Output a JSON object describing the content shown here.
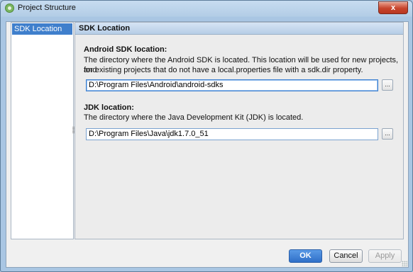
{
  "window": {
    "title": "Project Structure",
    "close_label": "x"
  },
  "sidebar": {
    "items": [
      {
        "label": "SDK Location",
        "selected": true
      }
    ]
  },
  "panel": {
    "header": "SDK Location",
    "android_sdk": {
      "heading": "Android SDK location:",
      "description_line1": "The directory where the Android SDK is located. This location will be used for new projects, and",
      "description_line2": "for existing projects that do not have a local.properties file with a sdk.dir property.",
      "path": "D:\\Program Files\\Android\\android-sdks",
      "browse_label": "..."
    },
    "jdk": {
      "heading": "JDK location:",
      "description": "The directory where the Java Development Kit (JDK) is located.",
      "path": "D:\\Program Files\\Java\\jdk1.7.0_51",
      "browse_label": "..."
    }
  },
  "buttons": {
    "ok": "OK",
    "cancel": "Cancel",
    "apply": "Apply"
  },
  "colors": {
    "accent": "#3f7fcc",
    "close": "#c7442c"
  }
}
